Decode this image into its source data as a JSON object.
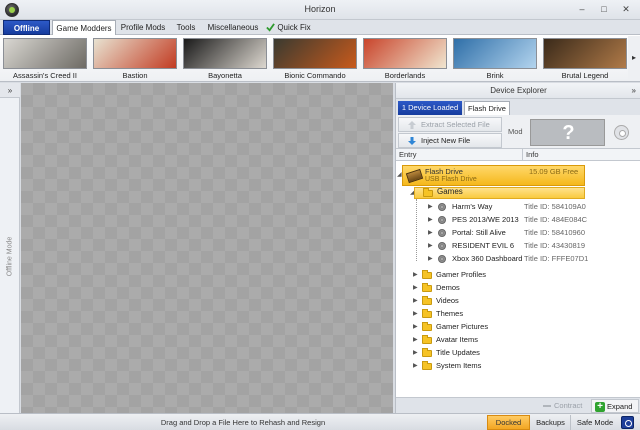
{
  "window": {
    "title": "Horizon",
    "controls": [
      "–",
      "□",
      "✕"
    ]
  },
  "menu": {
    "offline_label": "Offline",
    "tabs": [
      "Game Modders",
      "Profile Mods",
      "Tools",
      "Miscellaneous",
      "Quick Fix"
    ],
    "active_tab": "Game Modders"
  },
  "games": [
    {
      "name": "Assassin's Creed II",
      "colors": [
        "#d9d7d2",
        "#6d6a64"
      ]
    },
    {
      "name": "Bastion",
      "colors": [
        "#e8e2d1",
        "#c23b22"
      ]
    },
    {
      "name": "Bayonetta",
      "colors": [
        "#1a1a1a",
        "#ddd8d0"
      ]
    },
    {
      "name": "Bionic Commando",
      "colors": [
        "#3a3a30",
        "#c85a1c"
      ]
    },
    {
      "name": "Borderlands",
      "colors": [
        "#c9452c",
        "#f0e6d0"
      ]
    },
    {
      "name": "Brink",
      "colors": [
        "#2f6fa8",
        "#b3d4ee"
      ]
    },
    {
      "name": "Brutal Legend",
      "colors": [
        "#3a2a1a",
        "#b07a48"
      ]
    }
  ],
  "strip_arrow": "▸",
  "left_rail": {
    "collapse_glyph": "»",
    "label": "Offline Mode"
  },
  "device_explorer": {
    "title": "Device Explorer",
    "collapse_glyph": "»",
    "device_count_tab": "1 Device Loaded",
    "device_tab": "Flash Drive",
    "extract_label": "Extract Selected File",
    "inject_label": "Inject New File",
    "mod_label": "Mod",
    "mod_placeholder": "?",
    "columns": {
      "entry": "Entry",
      "info": "Info"
    },
    "drive": {
      "name": "Flash Drive",
      "type": "USB Flash Drive",
      "free": "15.09 GB Free"
    },
    "games_folder": "Games",
    "games": [
      {
        "name": "Harm's Way",
        "info": "Title ID: 584109A0"
      },
      {
        "name": "PES 2013/WE 2013",
        "info": "Title ID: 484E084C"
      },
      {
        "name": "Portal: Still Alive",
        "info": "Title ID: 58410960"
      },
      {
        "name": "RESIDENT EVIL 6",
        "info": "Title ID: 43430819"
      },
      {
        "name": "Xbox 360 Dashboard",
        "info": "Title ID: FFFE07D1"
      }
    ],
    "folders": [
      "Gamer Profiles",
      "Demos",
      "Videos",
      "Themes",
      "Gamer Pictures",
      "Avatar Items",
      "Title Updates",
      "System Items"
    ],
    "contract_label": "Contract",
    "expand_label": "Expand"
  },
  "status": {
    "message": "Drag and Drop a File Here to Rehash and Resign",
    "docked": "Docked",
    "backups": "Backups",
    "safe_mode": "Safe Mode"
  }
}
